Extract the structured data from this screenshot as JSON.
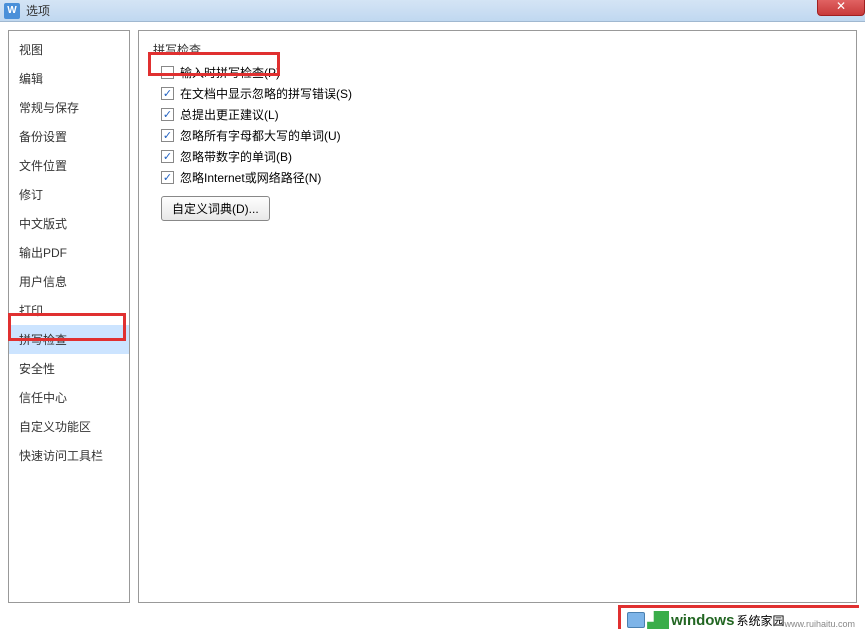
{
  "titlebar": {
    "icon_letter": "W",
    "title": "选项",
    "close_glyph": "✕"
  },
  "sidebar": {
    "items": [
      {
        "label": "视图"
      },
      {
        "label": "编辑"
      },
      {
        "label": "常规与保存"
      },
      {
        "label": "备份设置"
      },
      {
        "label": "文件位置"
      },
      {
        "label": "修订"
      },
      {
        "label": "中文版式"
      },
      {
        "label": "输出PDF"
      },
      {
        "label": "用户信息"
      },
      {
        "label": "打印"
      },
      {
        "label": "拼写检查",
        "selected": true
      },
      {
        "label": "安全性"
      },
      {
        "label": "信任中心"
      },
      {
        "label": "自定义功能区"
      },
      {
        "label": "快速访问工具栏"
      }
    ]
  },
  "content": {
    "group_title": "拼写检查",
    "checks": [
      {
        "label": "输入时拼写检查(P)",
        "checked": false
      },
      {
        "label": "在文档中显示忽略的拼写错误(S)",
        "checked": true
      },
      {
        "label": "总提出更正建议(L)",
        "checked": true
      },
      {
        "label": "忽略所有字母都大写的单词(U)",
        "checked": true
      },
      {
        "label": "忽略带数字的单词(B)",
        "checked": true
      },
      {
        "label": "忽略Internet或网络路径(N)",
        "checked": true
      }
    ],
    "custom_dict_btn": "自定义词典(D)..."
  },
  "watermark": {
    "text": "windows",
    "suffix": "系统家园",
    "url": "www.ruihaitu.com"
  }
}
